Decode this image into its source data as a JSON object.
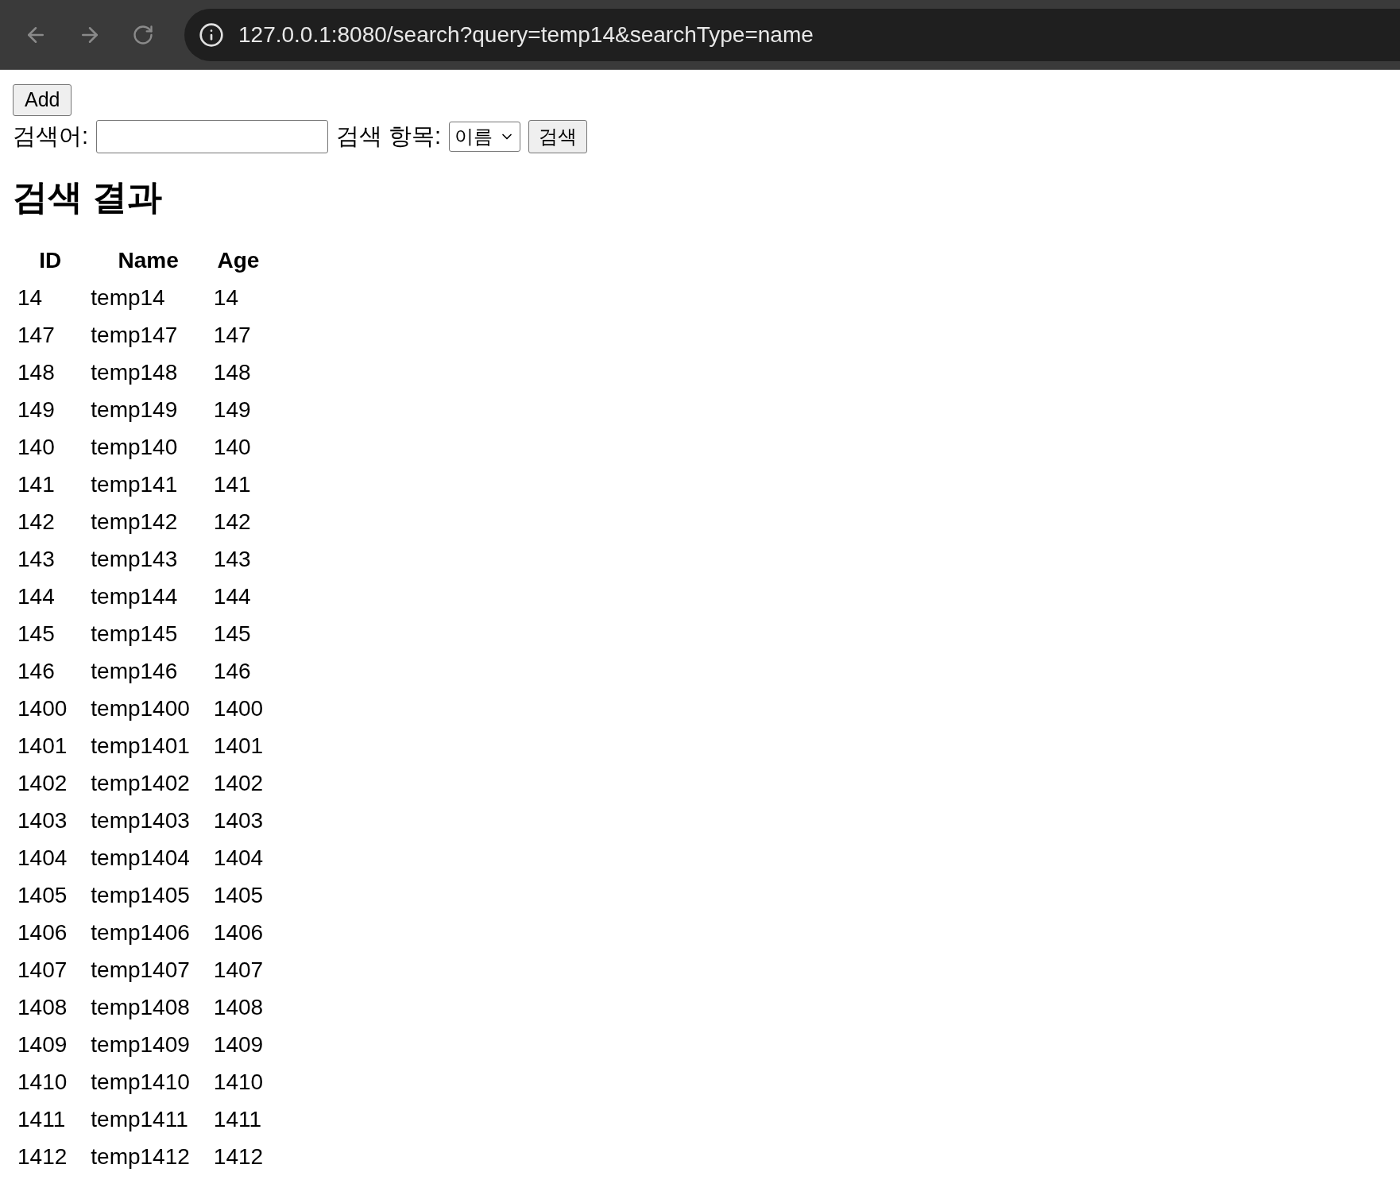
{
  "browser": {
    "url": "127.0.0.1:8080/search?query=temp14&searchType=name"
  },
  "add_button": "Add",
  "search": {
    "query_label": "검색어:",
    "type_label": "검색 항목:",
    "type_value": "이름",
    "submit": "검색"
  },
  "heading": "검색 결과",
  "table": {
    "columns": [
      "ID",
      "Name",
      "Age"
    ],
    "rows": [
      [
        "14",
        "temp14",
        "14"
      ],
      [
        "147",
        "temp147",
        "147"
      ],
      [
        "148",
        "temp148",
        "148"
      ],
      [
        "149",
        "temp149",
        "149"
      ],
      [
        "140",
        "temp140",
        "140"
      ],
      [
        "141",
        "temp141",
        "141"
      ],
      [
        "142",
        "temp142",
        "142"
      ],
      [
        "143",
        "temp143",
        "143"
      ],
      [
        "144",
        "temp144",
        "144"
      ],
      [
        "145",
        "temp145",
        "145"
      ],
      [
        "146",
        "temp146",
        "146"
      ],
      [
        "1400",
        "temp1400",
        "1400"
      ],
      [
        "1401",
        "temp1401",
        "1401"
      ],
      [
        "1402",
        "temp1402",
        "1402"
      ],
      [
        "1403",
        "temp1403",
        "1403"
      ],
      [
        "1404",
        "temp1404",
        "1404"
      ],
      [
        "1405",
        "temp1405",
        "1405"
      ],
      [
        "1406",
        "temp1406",
        "1406"
      ],
      [
        "1407",
        "temp1407",
        "1407"
      ],
      [
        "1408",
        "temp1408",
        "1408"
      ],
      [
        "1409",
        "temp1409",
        "1409"
      ],
      [
        "1410",
        "temp1410",
        "1410"
      ],
      [
        "1411",
        "temp1411",
        "1411"
      ],
      [
        "1412",
        "temp1412",
        "1412"
      ]
    ]
  }
}
